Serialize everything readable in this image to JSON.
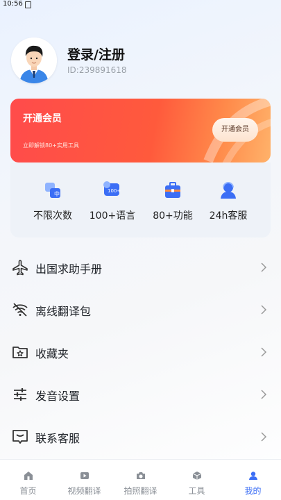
{
  "status_bar": {
    "time": "10:56"
  },
  "profile": {
    "title": "登录/注册",
    "user_id": "ID:239891618"
  },
  "vip": {
    "title": "开通会员",
    "subtitle": "立即解锁80+实用工具",
    "button": "开通会员",
    "accent": "#ff4b4b"
  },
  "benefits": [
    {
      "label": "不限次数",
      "icon": "translate-icon"
    },
    {
      "label": "100+语言",
      "icon": "language-icon"
    },
    {
      "label": "80+功能",
      "icon": "toolbox-icon"
    },
    {
      "label": "24h客服",
      "icon": "support-agent-icon"
    }
  ],
  "menu": [
    {
      "label": "出国求助手册",
      "icon": "airplane-icon"
    },
    {
      "label": "离线翻译包",
      "icon": "wifi-off-icon"
    },
    {
      "label": "收藏夹",
      "icon": "folder-star-icon"
    },
    {
      "label": "发音设置",
      "icon": "sliders-icon"
    },
    {
      "label": "联系客服",
      "icon": "message-icon"
    }
  ],
  "tabs": [
    {
      "label": "首页",
      "icon": "home-icon"
    },
    {
      "label": "视频翻译",
      "icon": "video-icon"
    },
    {
      "label": "拍照翻译",
      "icon": "camera-icon"
    },
    {
      "label": "工具",
      "icon": "cube-icon"
    },
    {
      "label": "我的",
      "icon": "person-icon",
      "active": true
    }
  ],
  "colors": {
    "primary": "#3b6ef5"
  }
}
